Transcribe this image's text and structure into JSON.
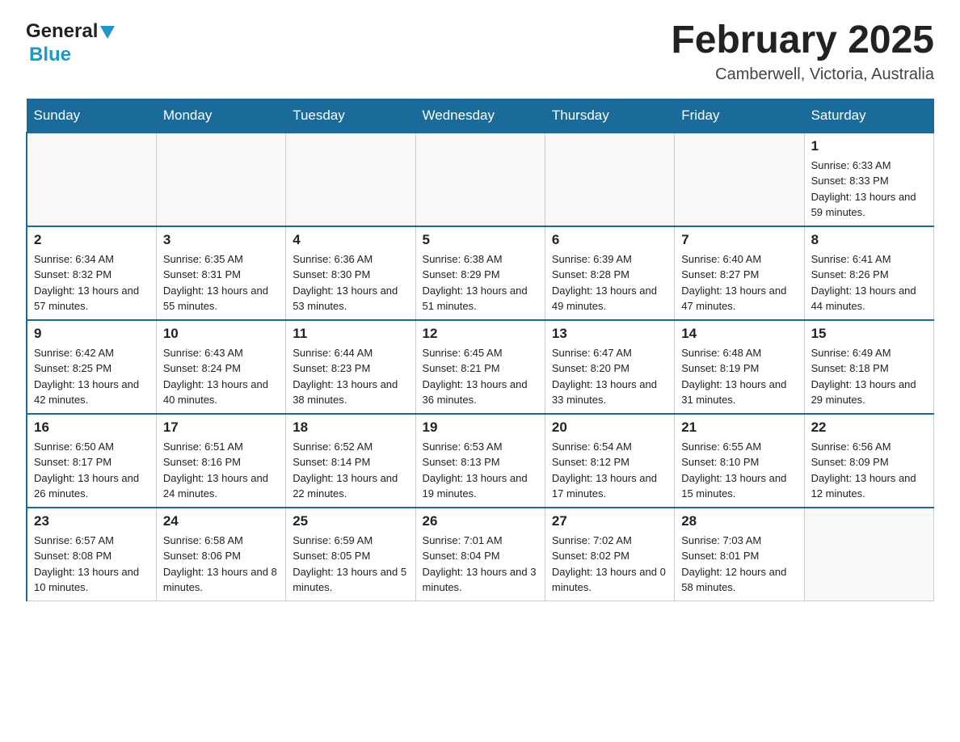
{
  "header": {
    "logo_general": "General",
    "logo_blue": "Blue",
    "month_title": "February 2025",
    "location": "Camberwell, Victoria, Australia"
  },
  "days_of_week": [
    "Sunday",
    "Monday",
    "Tuesday",
    "Wednesday",
    "Thursday",
    "Friday",
    "Saturday"
  ],
  "weeks": [
    [
      {
        "day": "",
        "sunrise": "",
        "sunset": "",
        "daylight": ""
      },
      {
        "day": "",
        "sunrise": "",
        "sunset": "",
        "daylight": ""
      },
      {
        "day": "",
        "sunrise": "",
        "sunset": "",
        "daylight": ""
      },
      {
        "day": "",
        "sunrise": "",
        "sunset": "",
        "daylight": ""
      },
      {
        "day": "",
        "sunrise": "",
        "sunset": "",
        "daylight": ""
      },
      {
        "day": "",
        "sunrise": "",
        "sunset": "",
        "daylight": ""
      },
      {
        "day": "1",
        "sunrise": "Sunrise: 6:33 AM",
        "sunset": "Sunset: 8:33 PM",
        "daylight": "Daylight: 13 hours and 59 minutes."
      }
    ],
    [
      {
        "day": "2",
        "sunrise": "Sunrise: 6:34 AM",
        "sunset": "Sunset: 8:32 PM",
        "daylight": "Daylight: 13 hours and 57 minutes."
      },
      {
        "day": "3",
        "sunrise": "Sunrise: 6:35 AM",
        "sunset": "Sunset: 8:31 PM",
        "daylight": "Daylight: 13 hours and 55 minutes."
      },
      {
        "day": "4",
        "sunrise": "Sunrise: 6:36 AM",
        "sunset": "Sunset: 8:30 PM",
        "daylight": "Daylight: 13 hours and 53 minutes."
      },
      {
        "day": "5",
        "sunrise": "Sunrise: 6:38 AM",
        "sunset": "Sunset: 8:29 PM",
        "daylight": "Daylight: 13 hours and 51 minutes."
      },
      {
        "day": "6",
        "sunrise": "Sunrise: 6:39 AM",
        "sunset": "Sunset: 8:28 PM",
        "daylight": "Daylight: 13 hours and 49 minutes."
      },
      {
        "day": "7",
        "sunrise": "Sunrise: 6:40 AM",
        "sunset": "Sunset: 8:27 PM",
        "daylight": "Daylight: 13 hours and 47 minutes."
      },
      {
        "day": "8",
        "sunrise": "Sunrise: 6:41 AM",
        "sunset": "Sunset: 8:26 PM",
        "daylight": "Daylight: 13 hours and 44 minutes."
      }
    ],
    [
      {
        "day": "9",
        "sunrise": "Sunrise: 6:42 AM",
        "sunset": "Sunset: 8:25 PM",
        "daylight": "Daylight: 13 hours and 42 minutes."
      },
      {
        "day": "10",
        "sunrise": "Sunrise: 6:43 AM",
        "sunset": "Sunset: 8:24 PM",
        "daylight": "Daylight: 13 hours and 40 minutes."
      },
      {
        "day": "11",
        "sunrise": "Sunrise: 6:44 AM",
        "sunset": "Sunset: 8:23 PM",
        "daylight": "Daylight: 13 hours and 38 minutes."
      },
      {
        "day": "12",
        "sunrise": "Sunrise: 6:45 AM",
        "sunset": "Sunset: 8:21 PM",
        "daylight": "Daylight: 13 hours and 36 minutes."
      },
      {
        "day": "13",
        "sunrise": "Sunrise: 6:47 AM",
        "sunset": "Sunset: 8:20 PM",
        "daylight": "Daylight: 13 hours and 33 minutes."
      },
      {
        "day": "14",
        "sunrise": "Sunrise: 6:48 AM",
        "sunset": "Sunset: 8:19 PM",
        "daylight": "Daylight: 13 hours and 31 minutes."
      },
      {
        "day": "15",
        "sunrise": "Sunrise: 6:49 AM",
        "sunset": "Sunset: 8:18 PM",
        "daylight": "Daylight: 13 hours and 29 minutes."
      }
    ],
    [
      {
        "day": "16",
        "sunrise": "Sunrise: 6:50 AM",
        "sunset": "Sunset: 8:17 PM",
        "daylight": "Daylight: 13 hours and 26 minutes."
      },
      {
        "day": "17",
        "sunrise": "Sunrise: 6:51 AM",
        "sunset": "Sunset: 8:16 PM",
        "daylight": "Daylight: 13 hours and 24 minutes."
      },
      {
        "day": "18",
        "sunrise": "Sunrise: 6:52 AM",
        "sunset": "Sunset: 8:14 PM",
        "daylight": "Daylight: 13 hours and 22 minutes."
      },
      {
        "day": "19",
        "sunrise": "Sunrise: 6:53 AM",
        "sunset": "Sunset: 8:13 PM",
        "daylight": "Daylight: 13 hours and 19 minutes."
      },
      {
        "day": "20",
        "sunrise": "Sunrise: 6:54 AM",
        "sunset": "Sunset: 8:12 PM",
        "daylight": "Daylight: 13 hours and 17 minutes."
      },
      {
        "day": "21",
        "sunrise": "Sunrise: 6:55 AM",
        "sunset": "Sunset: 8:10 PM",
        "daylight": "Daylight: 13 hours and 15 minutes."
      },
      {
        "day": "22",
        "sunrise": "Sunrise: 6:56 AM",
        "sunset": "Sunset: 8:09 PM",
        "daylight": "Daylight: 13 hours and 12 minutes."
      }
    ],
    [
      {
        "day": "23",
        "sunrise": "Sunrise: 6:57 AM",
        "sunset": "Sunset: 8:08 PM",
        "daylight": "Daylight: 13 hours and 10 minutes."
      },
      {
        "day": "24",
        "sunrise": "Sunrise: 6:58 AM",
        "sunset": "Sunset: 8:06 PM",
        "daylight": "Daylight: 13 hours and 8 minutes."
      },
      {
        "day": "25",
        "sunrise": "Sunrise: 6:59 AM",
        "sunset": "Sunset: 8:05 PM",
        "daylight": "Daylight: 13 hours and 5 minutes."
      },
      {
        "day": "26",
        "sunrise": "Sunrise: 7:01 AM",
        "sunset": "Sunset: 8:04 PM",
        "daylight": "Daylight: 13 hours and 3 minutes."
      },
      {
        "day": "27",
        "sunrise": "Sunrise: 7:02 AM",
        "sunset": "Sunset: 8:02 PM",
        "daylight": "Daylight: 13 hours and 0 minutes."
      },
      {
        "day": "28",
        "sunrise": "Sunrise: 7:03 AM",
        "sunset": "Sunset: 8:01 PM",
        "daylight": "Daylight: 12 hours and 58 minutes."
      },
      {
        "day": "",
        "sunrise": "",
        "sunset": "",
        "daylight": ""
      }
    ]
  ]
}
